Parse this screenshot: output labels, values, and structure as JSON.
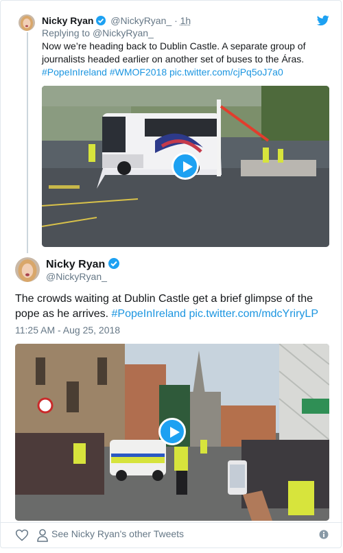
{
  "parent_tweet": {
    "name": "Nicky Ryan",
    "handle": "@NickyRyan_",
    "separator": "·",
    "time": "1h",
    "replying_prefix": "Replying to",
    "replying_to": "@NickyRyan_",
    "text": "Now we’re heading back to Dublin Castle. A separate group of journalists headed earlier on another set of buses to the Áras.",
    "hashtag_1": "#PopeInIreland",
    "hashtag_2": "#WMOF2018",
    "link": "pic.twitter.com/cjPq5oJ7a0"
  },
  "main_tweet": {
    "name": "Nicky Ryan",
    "handle": "@NickyRyan_",
    "text": "The crowds waiting at Dublin Castle get a brief glimpse of the pope as he arrives.",
    "hashtag": "#PopeInIreland",
    "link": "pic.twitter.com/mdcYriryLP",
    "timestamp": "11:25 AM - Aug 25, 2018"
  },
  "footer": {
    "other_tweets_label": "See Nicky Ryan's other Tweets"
  },
  "icons": {
    "verified": "verified-badge-icon",
    "twitter": "twitter-bird-icon",
    "play": "play-icon",
    "like": "heart-icon",
    "profile": "person-icon",
    "info": "info-icon"
  },
  "colors": {
    "accent": "#1da1f2",
    "link": "#1b95e0",
    "muted": "#657786",
    "text": "#14171a",
    "border": "#e1e8ed"
  }
}
